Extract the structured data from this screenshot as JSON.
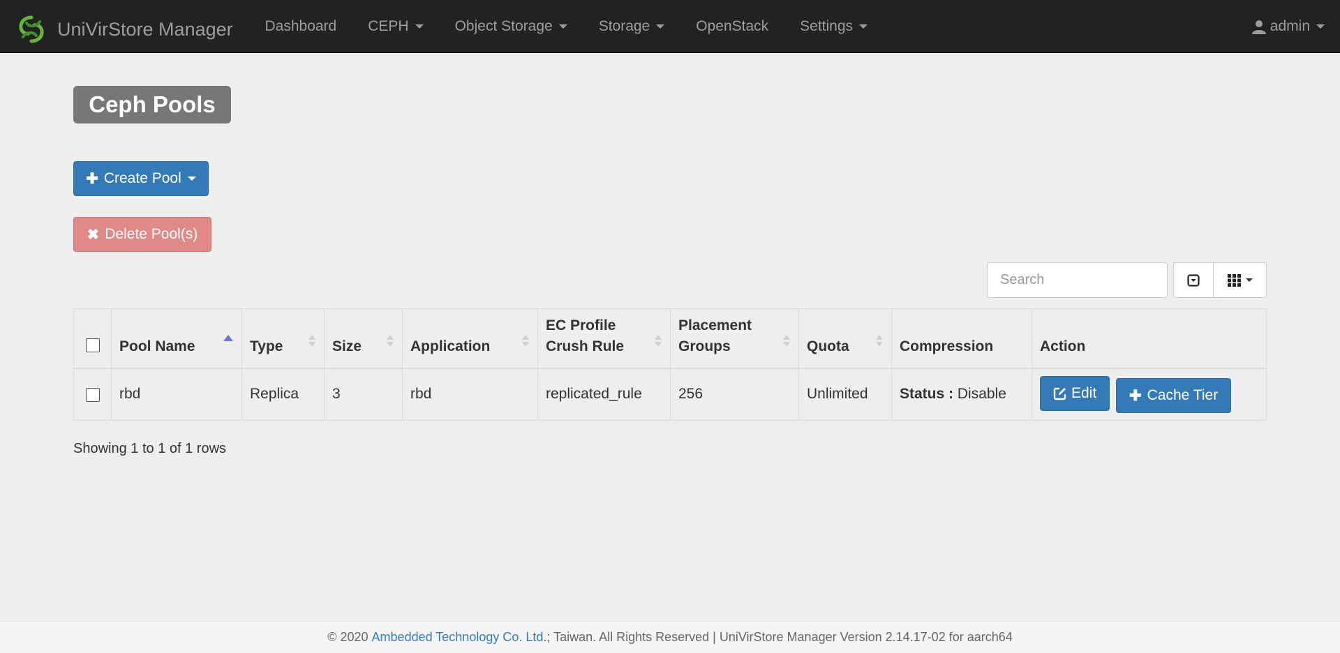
{
  "navbar": {
    "brand": "UniVirStore Manager",
    "items": [
      {
        "label": "Dashboard",
        "dropdown": false
      },
      {
        "label": "CEPH",
        "dropdown": true
      },
      {
        "label": "Object Storage",
        "dropdown": true
      },
      {
        "label": "Storage",
        "dropdown": true
      },
      {
        "label": "OpenStack",
        "dropdown": false
      },
      {
        "label": "Settings",
        "dropdown": true
      }
    ],
    "user": "admin"
  },
  "page": {
    "title": "Ceph Pools",
    "create_button": "Create Pool",
    "delete_button": "Delete Pool(s)"
  },
  "toolbar": {
    "search_placeholder": "Search",
    "toggle_icon": "toggle-view-icon",
    "columns_icon": "grid-columns-icon"
  },
  "table": {
    "headers": {
      "pool_name": "Pool Name",
      "type": "Type",
      "size": "Size",
      "application": "Application",
      "ec_profile_1": "EC Profile",
      "ec_profile_2": "Crush Rule",
      "pg_1": "Placement",
      "pg_2": "Groups",
      "quota": "Quota",
      "compression": "Compression",
      "action": "Action"
    },
    "rows": [
      {
        "pool_name": "rbd",
        "type": "Replica",
        "size": "3",
        "application": "rbd",
        "crush_rule": "replicated_rule",
        "placement_groups": "256",
        "quota": "Unlimited",
        "compression_label": "Status :",
        "compression_value": "Disable",
        "edit_button": "Edit",
        "cache_button": "Cache Tier"
      }
    ],
    "showing": "Showing 1 to 1 of 1 rows"
  },
  "footer": {
    "prefix": "© 2020 ",
    "company": "Ambedded Technology Co. Ltd.",
    "suffix": "; Taiwan. All Rights Reserved | UniVirStore Manager Version 2.14.17-02 for aarch64"
  },
  "colors": {
    "navbar_bg": "#222222",
    "primary": "#337ab7",
    "danger": "#e08a88",
    "page_bg": "#eeeeee",
    "title_bg": "#777777",
    "logo_green": "#6ab43e"
  }
}
